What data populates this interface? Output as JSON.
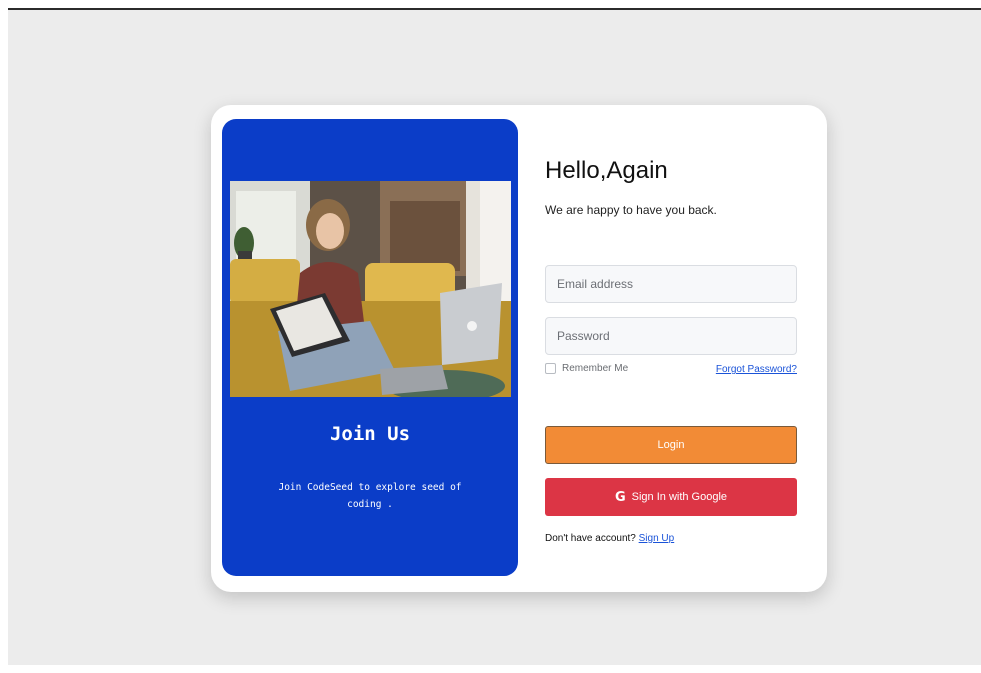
{
  "join": {
    "title": "Join Us",
    "text": "Join CodeSeed to explore seed of coding ."
  },
  "login": {
    "greeting": "Hello,Again",
    "subtitle": "We are happy to have you back.",
    "email_placeholder": "Email address",
    "password_placeholder": "Password",
    "remember_label": "Remember Me",
    "forgot_label": "Forgot Password?",
    "login_label": "Login",
    "google_label": "Sign In with Google",
    "google_icon": "G",
    "no_account_text": "Don't have account?",
    "signup_label": "Sign Up"
  },
  "colors": {
    "left_panel": "#0b3dc8",
    "login_button": "#f28b36",
    "google_button": "#dc3545",
    "link": "#1a53d8",
    "page_background": "#ececec"
  }
}
